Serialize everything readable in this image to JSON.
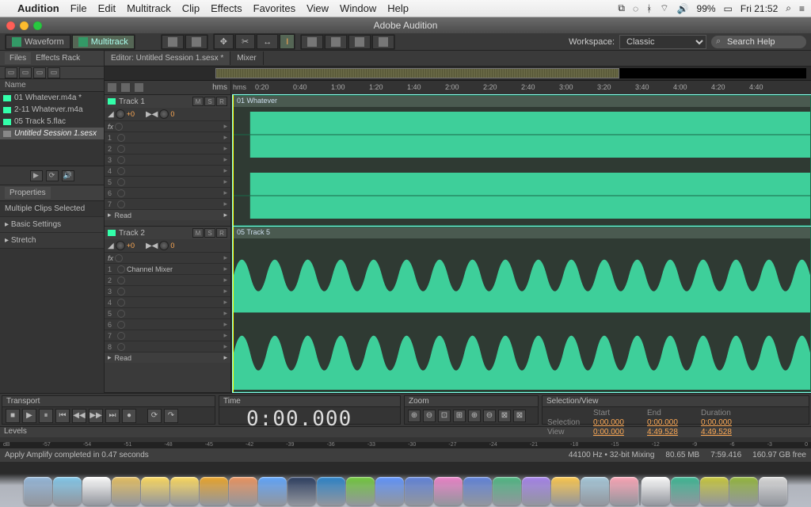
{
  "menubar": {
    "apple": "",
    "appname": "Audition",
    "items": [
      "File",
      "Edit",
      "Multitrack",
      "Clip",
      "Effects",
      "Favorites",
      "View",
      "Window",
      "Help"
    ],
    "battery": "99%",
    "clock": "Fri 21:52"
  },
  "titlebar": {
    "title": "Adobe Audition"
  },
  "toolbar": {
    "waveform": "Waveform",
    "multitrack": "Multitrack",
    "workspace_label": "Workspace:",
    "workspace_value": "Classic",
    "search_placeholder": "Search Help"
  },
  "files": {
    "tab1": "Files",
    "tab2": "Effects Rack",
    "colhdr": "Name",
    "items": [
      {
        "label": "01 Whatever.m4a *"
      },
      {
        "label": "2-11 Whatever.m4a"
      },
      {
        "label": "05 Track 5.flac"
      },
      {
        "label": "Untitled Session 1.sesx",
        "sel": true
      }
    ]
  },
  "properties": {
    "title": "Properties",
    "msg": "Multiple Clips Selected",
    "rows": [
      "Basic Settings",
      "Stretch"
    ]
  },
  "editor": {
    "tab1": "Editor: Untitled Session 1.sesx *",
    "tab2": "Mixer"
  },
  "timeline": {
    "unit": "hms",
    "marks": [
      "0:20",
      "0:40",
      "1:00",
      "1:20",
      "1:40",
      "2:00",
      "2:20",
      "2:40",
      "3:00",
      "3:20",
      "3:40",
      "4:00",
      "4:20",
      "4:40"
    ]
  },
  "tracks": [
    {
      "name": "Track 1",
      "clip": "01 Whatever",
      "m": "M",
      "s": "S",
      "r": "R",
      "gain": "+0",
      "read": "Read",
      "fxrows": [
        "1",
        "2",
        "3",
        "4",
        "5",
        "6",
        "7"
      ],
      "effect": ""
    },
    {
      "name": "Track 2",
      "clip": "05 Track 5",
      "m": "M",
      "s": "S",
      "r": "R",
      "gain": "+0",
      "read": "Read",
      "fxrows": [
        "1",
        "2",
        "3",
        "4",
        "5",
        "6",
        "7",
        "8"
      ],
      "effect": "Channel Mixer"
    }
  ],
  "transport": {
    "title": "Transport"
  },
  "time": {
    "title": "Time",
    "value": "0:00.000"
  },
  "zoom": {
    "title": "Zoom"
  },
  "selection": {
    "title": "Selection/View",
    "cols": [
      "Start",
      "End",
      "Duration"
    ],
    "rows": [
      {
        "label": "Selection",
        "start": "0:00.000",
        "end": "0:00.000",
        "dur": "0:00.000"
      },
      {
        "label": "View",
        "start": "0:00.000",
        "end": "4:49.528",
        "dur": "4:49.528"
      }
    ]
  },
  "levels": {
    "title": "Levels",
    "scale": [
      "dB",
      "-57",
      "-54",
      "-51",
      "-48",
      "-45",
      "-42",
      "-39",
      "-36",
      "-33",
      "-30",
      "-27",
      "-24",
      "-21",
      "-18",
      "-15",
      "-12",
      "-9",
      "-6",
      "-3",
      "0"
    ]
  },
  "status": {
    "msg": "Apply Amplify completed in 0.47 seconds",
    "sr": "44100 Hz",
    "bits": "32-bit Mixing",
    "mem": "80.65 MB",
    "dur": "7:59.416",
    "disk": "160.97 GB free"
  },
  "dock": {
    "count": 27
  }
}
